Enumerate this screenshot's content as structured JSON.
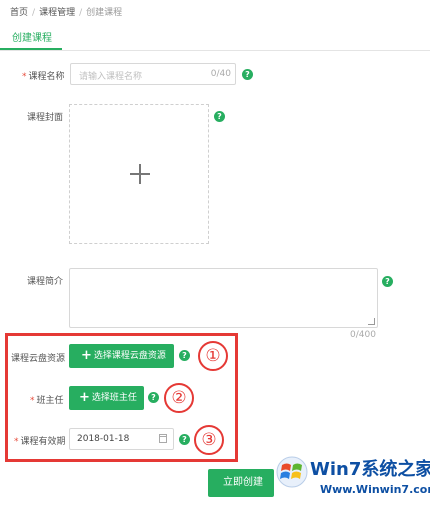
{
  "breadcrumb": {
    "items": [
      "首页",
      "课程管理",
      "创建课程"
    ],
    "separator": "/"
  },
  "tab": {
    "label": "创建课程"
  },
  "form": {
    "name": {
      "required": true,
      "label": "课程名称",
      "placeholder": "请输入课程名称",
      "count": "0/40"
    },
    "cover": {
      "label": "课程封面"
    },
    "intro": {
      "label": "课程简介",
      "count": "0/400"
    },
    "cloud": {
      "label": "课程云盘资源",
      "button": "选择课程云盘资源"
    },
    "teacher": {
      "required": true,
      "label": "班主任",
      "button": "选择班主任"
    },
    "validity": {
      "required": true,
      "label": "课程有效期",
      "value": "2018-01-18"
    },
    "help_icon": "?",
    "required_mark": "*",
    "plus_glyph": "+"
  },
  "submit": {
    "label": "立即创建"
  },
  "annotations": [
    "①",
    "②",
    "③"
  ],
  "watermark": {
    "brand": "Win7系统之家",
    "url": "Www.Winwin7.com"
  },
  "colors": {
    "accent": "#27ae60",
    "annotation": "#e53935",
    "watermark": "#0d4fa3"
  }
}
